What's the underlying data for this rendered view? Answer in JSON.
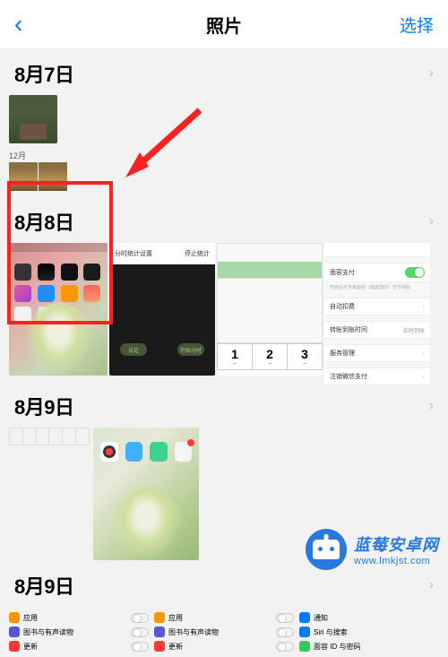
{
  "nav": {
    "title": "照片",
    "select": "选择"
  },
  "sections": [
    {
      "date": "8月7日",
      "sub_date": "12月"
    },
    {
      "date": "8月8日"
    },
    {
      "date": "8月9日"
    },
    {
      "date": "8月9日"
    }
  ],
  "screenshot_dark": {
    "top_left": "分时统计设置",
    "top_right": "停止统计",
    "btn1": "设定",
    "btn2": "开始分时"
  },
  "screenshot_tabs": {
    "nums": [
      "1",
      "2",
      "3"
    ],
    "sub": "--"
  },
  "screenshot_settings": {
    "face_pay": "面容支付",
    "face_desc": "开启后可享受面容（或其他ID）支付体验",
    "auto_deduct": "自动扣费",
    "transfer_time": "转账到账时间",
    "transfer_val": "实时到账",
    "service_mgmt": "服务管理",
    "wechat_pay": "注销微信支付"
  },
  "bottom": {
    "col1": [
      {
        "label": "应用",
        "color": "#ff9500"
      },
      {
        "label": "图书与有声读物",
        "color": "#5856d6"
      },
      {
        "label": "更新",
        "color": "#ff3b30"
      }
    ],
    "col2": [
      {
        "label": "应用",
        "color": "#ff9500"
      },
      {
        "label": "图书与有声读物",
        "color": "#5856d6"
      },
      {
        "label": "更新",
        "color": "#ff3b30"
      }
    ],
    "col3": [
      {
        "label": "通知",
        "color": "#007aff"
      },
      {
        "label": "Siri 与搜索",
        "color": "#007aff"
      },
      {
        "label": "面容 ID 与密码",
        "color": "#34c759"
      }
    ]
  },
  "watermark": {
    "title": "蓝莓安卓网",
    "url": "www.lmkjst.com"
  }
}
